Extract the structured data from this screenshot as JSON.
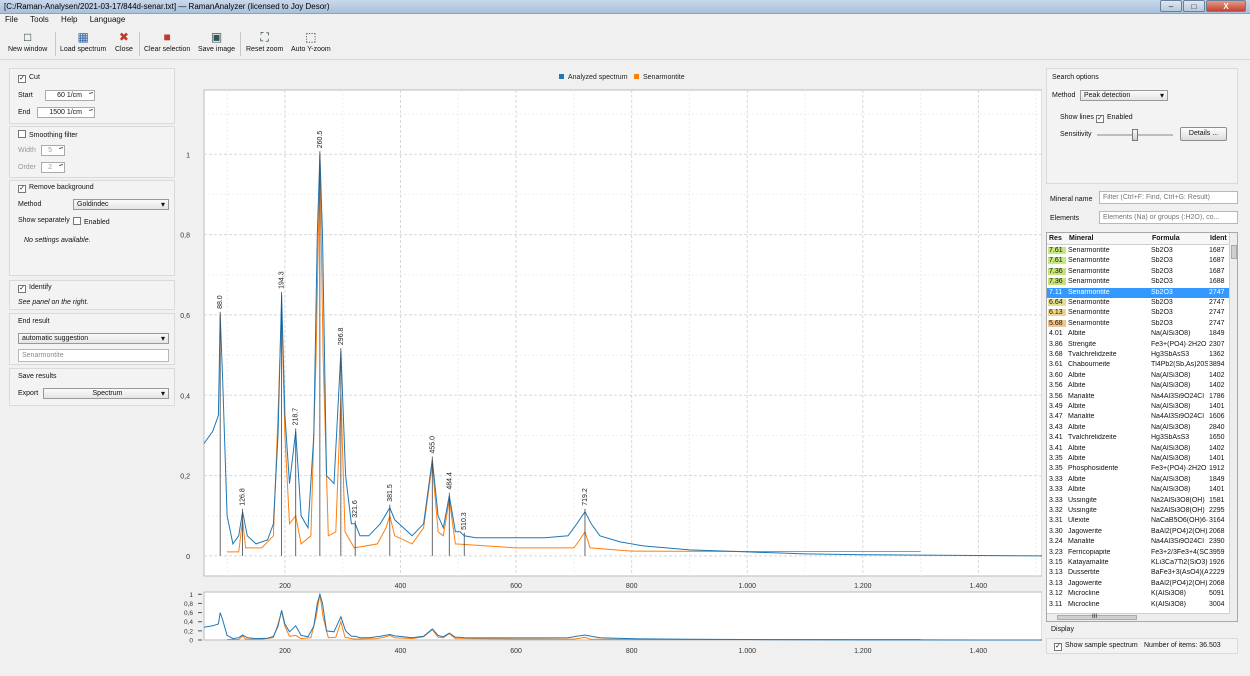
{
  "window": {
    "title": "[C:/Raman-Analysen/2021-03-17/844d-senar.txt] — RamanAnalyzer (licensed to Joy Desor)",
    "controls": [
      "–",
      "□",
      "X"
    ]
  },
  "menu": [
    "File",
    "Tools",
    "Help",
    "Language"
  ],
  "toolbar": {
    "new_window": "New window",
    "load_spectrum": "Load spectrum",
    "close": "Close",
    "clear_selection": "Clear selection",
    "save_image": "Save image",
    "reset_zoom": "Reset zoom",
    "auto_y_zoom": "Auto Y-zoom"
  },
  "left": {
    "cut": {
      "label": "Cut",
      "checked": true,
      "start_label": "Start",
      "start_value": "60 1/cm",
      "end_label": "End",
      "end_value": "1500 1/cm"
    },
    "smoothing": {
      "label": "Smoothing filter",
      "checked": false,
      "width_label": "Width",
      "width_value": "5",
      "order_label": "Order",
      "order_value": "2"
    },
    "background": {
      "label": "Remove background",
      "checked": true,
      "method_label": "Method",
      "method_value": "Goldindec",
      "show_sep_label": "Show separately",
      "enabled_label": "Enabled",
      "no_settings": "No settings available."
    },
    "identify": {
      "label": "Identify",
      "checked": true,
      "note": "See panel on the right."
    },
    "end_result": {
      "label": "End result",
      "select_value": "automatic suggestion",
      "field_value": "Senarmontite"
    },
    "save_results": {
      "label": "Save results",
      "export_label": "Export",
      "export_value": "Spectrum"
    }
  },
  "right": {
    "search_options": "Search options",
    "method_label": "Method",
    "method_value": "Peak detection",
    "show_lines_label": "Show lines",
    "enabled_label": "Enabled",
    "sensitivity_label": "Sensitivity",
    "sensitivity_level": 0.5,
    "details_button": "Details ...",
    "mineral_name_label": "Mineral name",
    "mineral_placeholder": "Filter (Ctrl+F: Find, Ctrl+G: Result)",
    "elements_label": "Elements",
    "elements_placeholder": "Elements (Na) or groups (:H2O), co...",
    "table_headers": [
      "Res",
      "Mineral",
      "Formula",
      "Ident"
    ],
    "rows": [
      [
        "7.61",
        "Senarmontite",
        "Sb2O3",
        "1687"
      ],
      [
        "7.61",
        "Senarmontite",
        "Sb2O3",
        "1687"
      ],
      [
        "7.36",
        "Senarmontite",
        "Sb2O3",
        "1687"
      ],
      [
        "7.36",
        "Senarmontite",
        "Sb2O3",
        "1688"
      ],
      [
        "7.11",
        "Senarmontite",
        "Sb2O3",
        "2747"
      ],
      [
        "6.64",
        "Senarmontite",
        "Sb2O3",
        "2747"
      ],
      [
        "6.13",
        "Senarmontite",
        "Sb2O3",
        "2747"
      ],
      [
        "5.68",
        "Senarmontite",
        "Sb2O3",
        "2747"
      ],
      [
        "4.01",
        "Albite",
        "Na(AlSi3O8)",
        "1849"
      ],
      [
        "3.86",
        "Strengite",
        "Fe3+(PO4)·2H2O",
        "2307"
      ],
      [
        "3.68",
        "Tvalchrelidzeite",
        "Hg3SbAsS3",
        "1362"
      ],
      [
        "3.61",
        "Chabourneite",
        "Tl4Pb2(Sb,As)20S34",
        "3894"
      ],
      [
        "3.60",
        "Albite",
        "Na(AlSi3O8)",
        "1402"
      ],
      [
        "3.56",
        "Albite",
        "Na(AlSi3O8)",
        "1402"
      ],
      [
        "3.56",
        "Marialite",
        "Na4Al3Si9O24Cl",
        "1786"
      ],
      [
        "3.49",
        "Albite",
        "Na(AlSi3O8)",
        "1401"
      ],
      [
        "3.47",
        "Marialite",
        "Na4Al3Si9O24Cl",
        "1606"
      ],
      [
        "3.43",
        "Albite",
        "Na(AlSi3O8)",
        "2840"
      ],
      [
        "3.41",
        "Tvalchrelidzeite",
        "Hg3SbAsS3",
        "1650"
      ],
      [
        "3.41",
        "Albite",
        "Na(AlSi3O8)",
        "1402"
      ],
      [
        "3.35",
        "Albite",
        "Na(AlSi3O8)",
        "1401"
      ],
      [
        "3.35",
        "Phosphosiderite",
        "Fe3+(PO4)·2H2O",
        "1912"
      ],
      [
        "3.33",
        "Albite",
        "Na(AlSi3O8)",
        "1849"
      ],
      [
        "3.33",
        "Albite",
        "Na(AlSi3O8)",
        "1401"
      ],
      [
        "3.33",
        "Ussingite",
        "Na2AlSi3O8(OH)",
        "1581"
      ],
      [
        "3.32",
        "Ussingite",
        "Na2AlSi3O8(OH)",
        "2295"
      ],
      [
        "3.31",
        "Ulexite",
        "NaCaB5O6(OH)6·5",
        "3164"
      ],
      [
        "3.30",
        "Jagowerite",
        "BaAl2(PO4)2(OH)2",
        "2068"
      ],
      [
        "3.24",
        "Marialite",
        "Na4Al3Si9O24Cl",
        "2390"
      ],
      [
        "3.23",
        "Ferricopiapite",
        "Fe3+2/3Fe3+4(SO4)",
        "3959"
      ],
      [
        "3.15",
        "Katayamalite",
        "KLi3Ca7Ti2(SiO3)12",
        "1926"
      ],
      [
        "3.13",
        "Dussertite",
        "BaFe3+3(AsO4)(As",
        "2229"
      ],
      [
        "3.13",
        "Jagowerite",
        "BaAl2(PO4)2(OH)2",
        "2068"
      ],
      [
        "3.12",
        "Microcline",
        "K(AlSi3O8)",
        "5091"
      ],
      [
        "3.11",
        "Microcline",
        "K(AlSi3O8)",
        "3004"
      ]
    ],
    "row_colors": [
      "#c3ea7a",
      "#c3ea7a",
      "#c8e27a",
      "#c8e27a",
      "#3399ff",
      "#e6e08a",
      "#f0d489",
      "#f1c58e"
    ],
    "hscroll_label": "III",
    "display_label": "Display",
    "show_sample_label": "Show sample spectrum",
    "items_label": "Number of items:",
    "items_value": "36.503"
  },
  "chart_data": {
    "type": "line",
    "title": "",
    "xlabel": "",
    "ylabel": "",
    "xlim": [
      60,
      1510
    ],
    "ylim": [
      -0.05,
      1.16
    ],
    "x_ticks": [
      200,
      400,
      600,
      800,
      1000,
      1200,
      1400
    ],
    "x_tick_labels": [
      "200",
      "400",
      "600",
      "800",
      "1.000",
      "1.200",
      "1.400"
    ],
    "y_ticks": [
      0,
      0.2,
      0.4,
      0.6,
      0.8,
      1
    ],
    "y_tick_labels": [
      "0",
      "0,2",
      "0,4",
      "0,6",
      "0,8",
      "1"
    ],
    "legend": [
      "Analyzed spectrum",
      "Senarmontite"
    ],
    "legend_position": "top-center",
    "grid": true,
    "series": [
      {
        "name": "Analyzed spectrum",
        "color": "#1f77b4",
        "points": [
          [
            60,
            0.28
          ],
          [
            75,
            0.31
          ],
          [
            85,
            0.35
          ],
          [
            88,
            0.6
          ],
          [
            92,
            0.45
          ],
          [
            100,
            0.1
          ],
          [
            110,
            0.03
          ],
          [
            120,
            0.05
          ],
          [
            126.8,
            0.11
          ],
          [
            135,
            0.05
          ],
          [
            150,
            0.03
          ],
          [
            170,
            0.04
          ],
          [
            180,
            0.08
          ],
          [
            188,
            0.3
          ],
          [
            194.3,
            0.65
          ],
          [
            200,
            0.35
          ],
          [
            208,
            0.18
          ],
          [
            218.7,
            0.31
          ],
          [
            228,
            0.1
          ],
          [
            240,
            0.07
          ],
          [
            250,
            0.3
          ],
          [
            256,
            0.8
          ],
          [
            260.5,
            1.0
          ],
          [
            265,
            0.8
          ],
          [
            272,
            0.2
          ],
          [
            285,
            0.18
          ],
          [
            296.8,
            0.51
          ],
          [
            305,
            0.2
          ],
          [
            315,
            0.08
          ],
          [
            321.6,
            0.08
          ],
          [
            330,
            0.05
          ],
          [
            345,
            0.05
          ],
          [
            365,
            0.08
          ],
          [
            381.5,
            0.12
          ],
          [
            390,
            0.09
          ],
          [
            405,
            0.07
          ],
          [
            420,
            0.05
          ],
          [
            440,
            0.08
          ],
          [
            455,
            0.24
          ],
          [
            465,
            0.1
          ],
          [
            474,
            0.07
          ],
          [
            484.4,
            0.15
          ],
          [
            495,
            0.06
          ],
          [
            503,
            0.06
          ],
          [
            510.3,
            0.05
          ],
          [
            530,
            0.045
          ],
          [
            600,
            0.045
          ],
          [
            650,
            0.045
          ],
          [
            690,
            0.05
          ],
          [
            705,
            0.08
          ],
          [
            719.2,
            0.11
          ],
          [
            730,
            0.08
          ],
          [
            745,
            0.05
          ],
          [
            780,
            0.035
          ],
          [
            820,
            0.025
          ],
          [
            900,
            0.015
          ],
          [
            1000,
            0.01
          ],
          [
            1100,
            0.005
          ],
          [
            1200,
            0.003
          ],
          [
            1300,
            0.002
          ],
          [
            1400,
            0.001
          ],
          [
            1510,
            0.0
          ]
        ]
      },
      {
        "name": "Senarmontite",
        "color": "#ff7f0e",
        "points": [
          [
            100,
            0.01
          ],
          [
            120,
            0.01
          ],
          [
            126.8,
            0.09
          ],
          [
            132,
            0.02
          ],
          [
            160,
            0.02
          ],
          [
            180,
            0.05
          ],
          [
            188,
            0.35
          ],
          [
            194.3,
            0.62
          ],
          [
            200,
            0.3
          ],
          [
            208,
            0.08
          ],
          [
            218.7,
            0.1
          ],
          [
            228,
            0.03
          ],
          [
            245,
            0.05
          ],
          [
            254,
            0.5
          ],
          [
            260.5,
            1.0
          ],
          [
            266,
            0.5
          ],
          [
            275,
            0.05
          ],
          [
            288,
            0.06
          ],
          [
            296.8,
            0.4
          ],
          [
            304,
            0.06
          ],
          [
            320,
            0.02
          ],
          [
            360,
            0.03
          ],
          [
            375,
            0.07
          ],
          [
            381.5,
            0.1
          ],
          [
            390,
            0.05
          ],
          [
            420,
            0.03
          ],
          [
            440,
            0.07
          ],
          [
            455,
            0.23
          ],
          [
            465,
            0.06
          ],
          [
            474,
            0.05
          ],
          [
            484.4,
            0.14
          ],
          [
            495,
            0.03
          ],
          [
            600,
            0.02
          ],
          [
            700,
            0.02
          ],
          [
            710,
            0.04
          ],
          [
            719.2,
            0.06
          ],
          [
            728,
            0.02
          ],
          [
            800,
            0.012
          ],
          [
            1000,
            0.011
          ],
          [
            1200,
            0.011
          ],
          [
            1300,
            0.011
          ]
        ]
      }
    ],
    "peak_labels": [
      88.0,
      126.8,
      194.3,
      218.7,
      260.5,
      296.8,
      321.6,
      381.5,
      455.0,
      484.4,
      510.3,
      719.2
    ],
    "overview": {
      "y_ticks": [
        0,
        0.2,
        0.4,
        0.6,
        0.8,
        1
      ],
      "y_tick_labels": [
        "0",
        "0,2",
        "0,4",
        "0,6",
        "0,8",
        "1"
      ],
      "x_tick_labels": [
        "200",
        "400",
        "600",
        "800",
        "1.000",
        "1.200",
        "1.400"
      ]
    }
  }
}
